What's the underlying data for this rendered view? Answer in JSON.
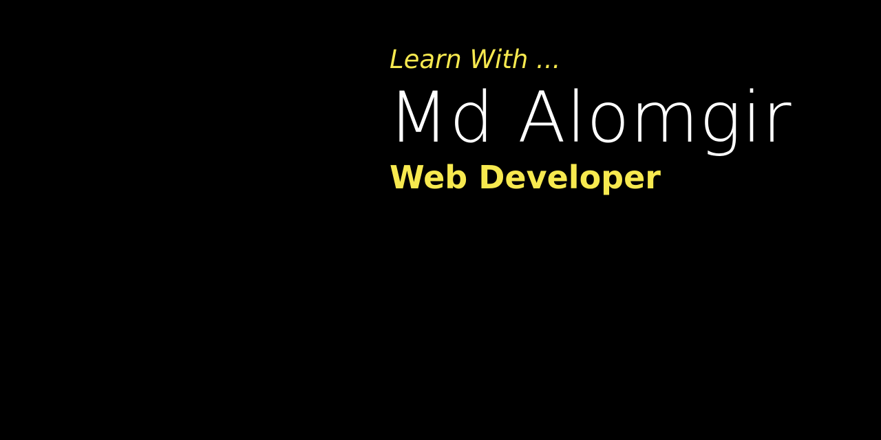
{
  "banner": {
    "tagline": "Learn With ...",
    "name": "Md Alomgir",
    "role": "Web Developer"
  },
  "colors": {
    "background": "#000000",
    "accent": "#f7e94f",
    "name": "#ffffff"
  }
}
